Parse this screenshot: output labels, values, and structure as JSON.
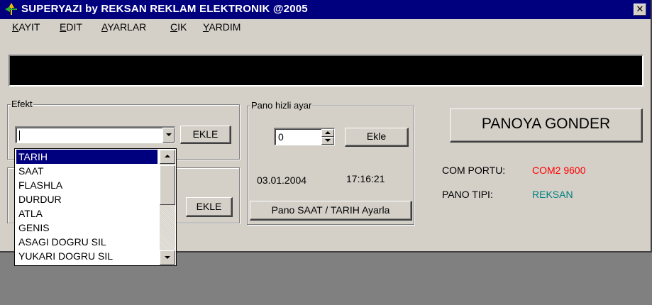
{
  "window": {
    "title": "SUPERYAZI by REKSAN REKLAM ELEKTRONIK @2005",
    "close_glyph": "✕"
  },
  "menu": {
    "items": [
      {
        "label": "KAYIT"
      },
      {
        "label": "EDIT"
      },
      {
        "label": "AYARLAR"
      },
      {
        "label": "CIK"
      },
      {
        "label": "YARDIM"
      }
    ]
  },
  "efekt": {
    "legend": "Efekt",
    "combo_value": "",
    "ekle_label": "EKLE",
    "options": [
      "TARIH",
      "SAAT",
      "FLASHLA",
      "DURDUR",
      "ATLA",
      "GENIS",
      "ASAGI DOGRU SIL",
      "YUKARI DOGRU SIL"
    ],
    "selected_option": "TARIH"
  },
  "second_group": {
    "ekle_label": "EKLE"
  },
  "pano_hizli": {
    "legend": "Pano hizli ayar",
    "spin_value": "0",
    "ekle_label": "Ekle",
    "date": "03.01.2004",
    "time": "17:16:21",
    "set_button_label": "Pano SAAT / TARIH Ayarla"
  },
  "send": {
    "button_label": "PANOYA GONDER"
  },
  "status": {
    "com_label": "COM PORTU:",
    "com_value": "COM2 9600",
    "com_color": "#ff0000",
    "pano_label": "PANO TIPI:",
    "pano_value": "REKSAN",
    "pano_color": "#008080"
  },
  "icons": {
    "title_icon": "reksan-logo-icon",
    "dropdown_arrow": "chevron-down-icon",
    "spin_up": "chevron-up-icon",
    "spin_down": "chevron-down-icon"
  }
}
